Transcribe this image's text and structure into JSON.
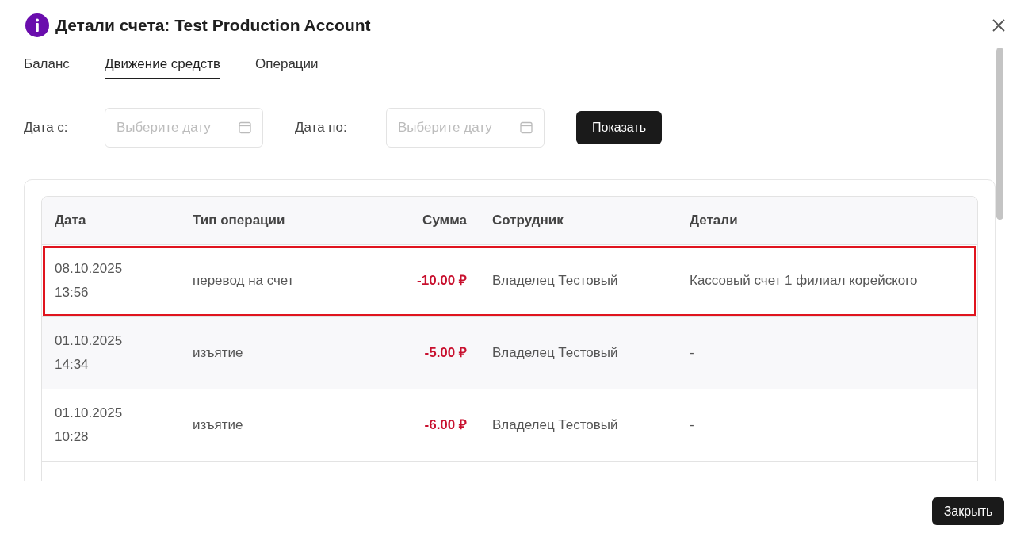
{
  "dialog": {
    "title": "Детали счета: Test Production Account",
    "close": "Закрыть"
  },
  "tabs": [
    {
      "label": "Баланс",
      "selected": false
    },
    {
      "label": "Движение средств",
      "selected": true
    },
    {
      "label": "Операции",
      "selected": false
    }
  ],
  "filters": {
    "from_label": "Дата с:",
    "from_placeholder": "Выберите дату",
    "to_label": "Дата по:",
    "to_placeholder": "Выберите дату",
    "show_button": "Показать"
  },
  "table": {
    "columns": [
      "Дата",
      "Тип операции",
      "Сумма",
      "Сотрудник",
      "Детали"
    ],
    "rows": [
      {
        "date": "08.10.2025",
        "time": "13:56",
        "type": "перевод на счет",
        "amount": "-10.00 ₽",
        "employee": "Владелец Тестовый",
        "details": "Кассовый счет 1 филиал корейского",
        "highlighted": true
      },
      {
        "date": "01.10.2025",
        "time": "14:34",
        "type": "изъятие",
        "amount": "-5.00 ₽",
        "employee": "Владелец Тестовый",
        "details": "-",
        "highlighted": false
      },
      {
        "date": "01.10.2025",
        "time": "10:28",
        "type": "изъятие",
        "amount": "-6.00 ₽",
        "employee": "Владелец Тестовый",
        "details": "-",
        "highlighted": false
      }
    ]
  }
}
